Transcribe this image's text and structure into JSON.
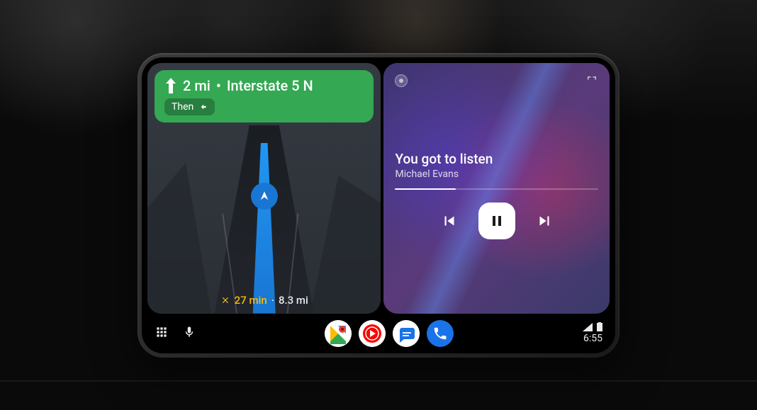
{
  "navigation": {
    "direction_distance": "2 mi",
    "direction_road": "Interstate 5 N",
    "then_label": "Then",
    "eta_time": "27 min",
    "eta_distance": "8.3 mi"
  },
  "media": {
    "track_title": "You got to listen",
    "track_artist": "Michael Evans"
  },
  "status": {
    "time": "6:55"
  },
  "apps": {
    "launcher": "app-launcher",
    "voice": "voice-assistant",
    "maps": "google-maps",
    "youtube_music": "youtube-music",
    "messages": "messages",
    "phone": "phone"
  }
}
